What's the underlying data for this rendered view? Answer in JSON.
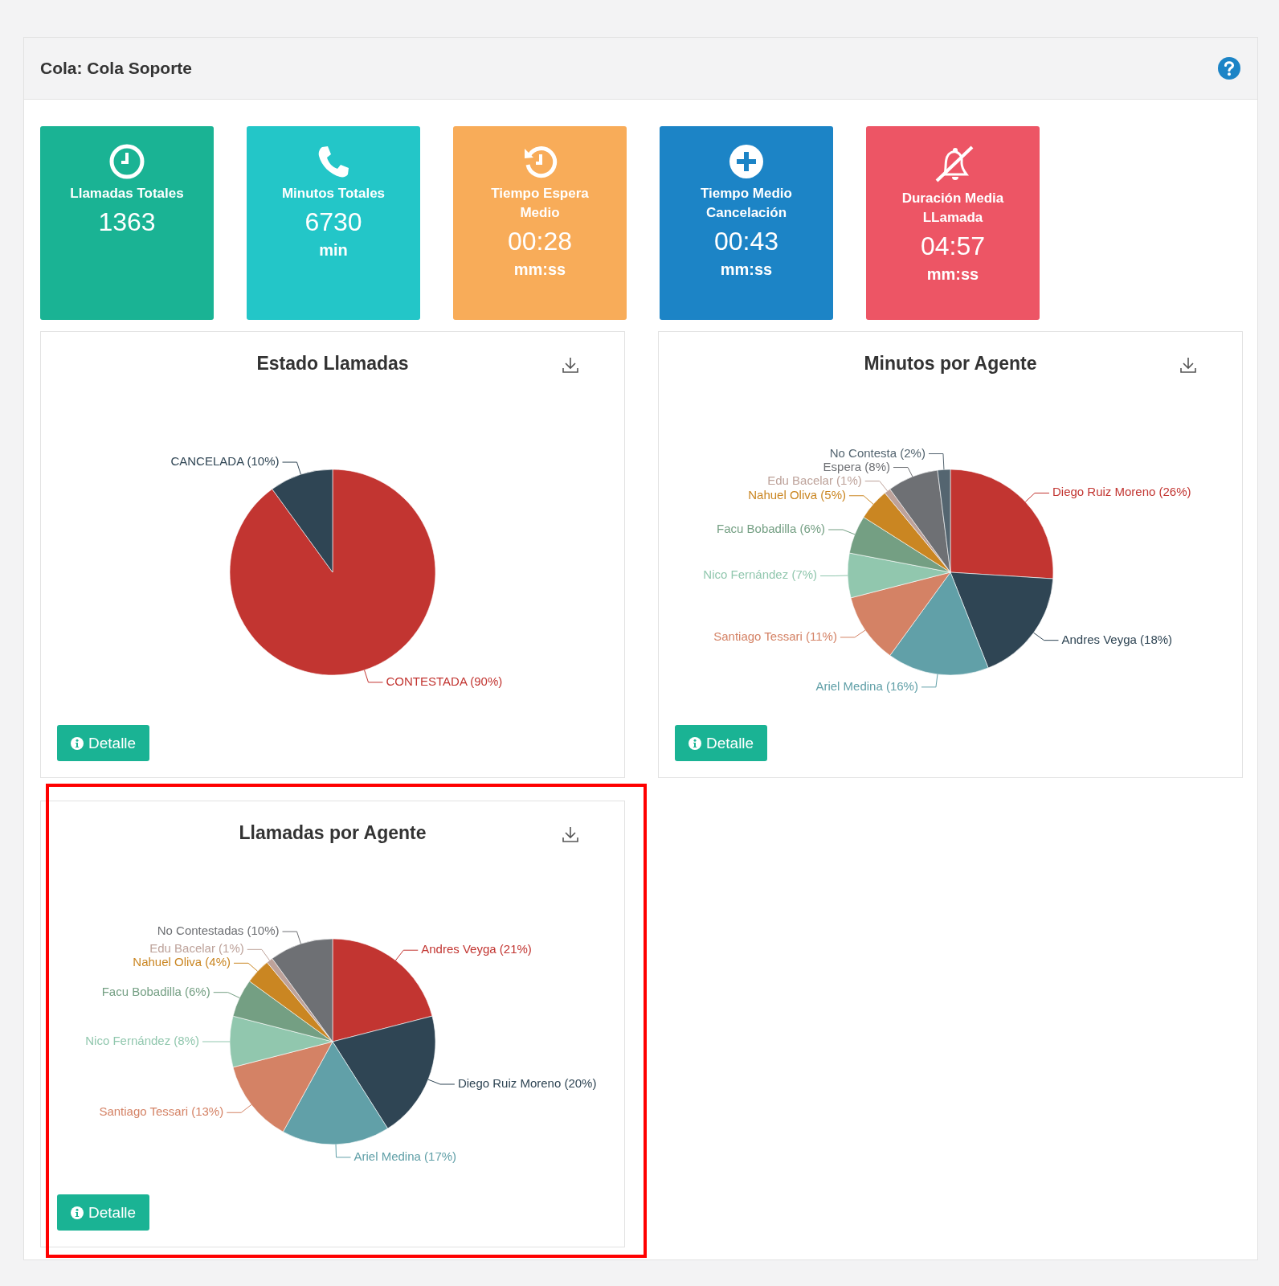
{
  "header": {
    "title": "Cola: Cola Soporte"
  },
  "stats": [
    {
      "kind": "clock",
      "color": "#1ab394",
      "title": "Llamadas Totales",
      "value": "1363"
    },
    {
      "kind": "phone",
      "color": "#23c6c8",
      "title": "Minutos Totales",
      "value": "6730",
      "unit": "min"
    },
    {
      "kind": "history",
      "color": "#f8ac59",
      "title": "Tiempo Espera Medio",
      "value": "00:28",
      "unit": "mm:ss"
    },
    {
      "kind": "plus",
      "color": "#1c84c6",
      "title": "Tiempo Medio Cancelación",
      "value": "00:43",
      "unit": "mm:ss"
    },
    {
      "kind": "bell-slash",
      "color": "#ed5565",
      "title": "Duración Media LLamada",
      "value": "04:57",
      "unit": "mm:ss"
    }
  ],
  "charts": [
    {
      "title": "Estado Llamadas",
      "button": "Detalle",
      "highlighted": false,
      "chart_data": {
        "type": "pie",
        "categories": [
          "CONTESTADA",
          "CANCELADA"
        ],
        "values": [
          90,
          10
        ],
        "colors": [
          "#c23531",
          "#2f4554"
        ],
        "value_labels": [
          "(90%)",
          "(10%)"
        ]
      }
    },
    {
      "title": "Minutos por Agente",
      "button": "Detalle",
      "highlighted": false,
      "chart_data": {
        "type": "pie",
        "categories": [
          "Diego Ruiz Moreno",
          "Andres Veyga",
          "Ariel Medina",
          "Santiago Tessari",
          "Nico Fernández",
          "Facu Bobadilla",
          "Nahuel Oliva",
          "Edu Bacelar",
          "Espera",
          "No Contesta"
        ],
        "values": [
          26,
          18,
          16,
          11,
          7,
          6,
          5,
          1,
          8,
          2
        ],
        "colors": [
          "#c23531",
          "#2f4554",
          "#61a0a8",
          "#d48265",
          "#91c7ae",
          "#749f83",
          "#ca8622",
          "#bda29a",
          "#6e7074",
          "#546570"
        ],
        "value_labels": [
          "(26%)",
          "(18%)",
          "(16%)",
          "(11%)",
          "(7%)",
          "(6%)",
          "(5%)",
          "(1%)",
          "(8%)",
          "(2%)"
        ]
      }
    },
    {
      "title": "Llamadas por Agente",
      "button": "Detalle",
      "highlighted": true,
      "chart_data": {
        "type": "pie",
        "categories": [
          "Andres Veyga",
          "Diego Ruiz Moreno",
          "Ariel Medina",
          "Santiago Tessari",
          "Nico Fernández",
          "Facu Bobadilla",
          "Nahuel Oliva",
          "Edu Bacelar",
          "No Contestadas"
        ],
        "values": [
          21,
          20,
          17,
          13,
          8,
          6,
          4,
          1,
          10
        ],
        "colors": [
          "#c23531",
          "#2f4554",
          "#61a0a8",
          "#d48265",
          "#91c7ae",
          "#749f83",
          "#ca8622",
          "#bda29a",
          "#6e7074"
        ],
        "value_labels": [
          "(21%)",
          "(20%)",
          "(17%)",
          "(13%)",
          "(8%)",
          "(6%)",
          "(4%)",
          "(1%)",
          "(10%)"
        ]
      }
    }
  ]
}
